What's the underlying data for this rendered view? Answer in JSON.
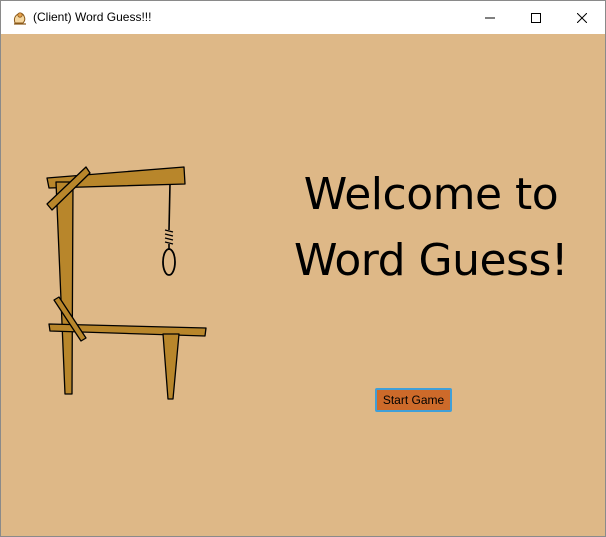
{
  "window": {
    "title": "(Client) Word Guess!!!",
    "app_icon": "java-duke-icon",
    "controls": [
      "minimize-icon",
      "maximize-icon",
      "close-icon"
    ]
  },
  "main": {
    "welcome_line1": "Welcome to",
    "welcome_line2": "Word Guess!",
    "start_button_label": "Start Game",
    "gallows_image": "gallows-icon"
  },
  "colors": {
    "background": "#deb887",
    "button_bg": "#cd6a2a",
    "button_border": "#3f9fd8",
    "wood": "#b8862b"
  }
}
